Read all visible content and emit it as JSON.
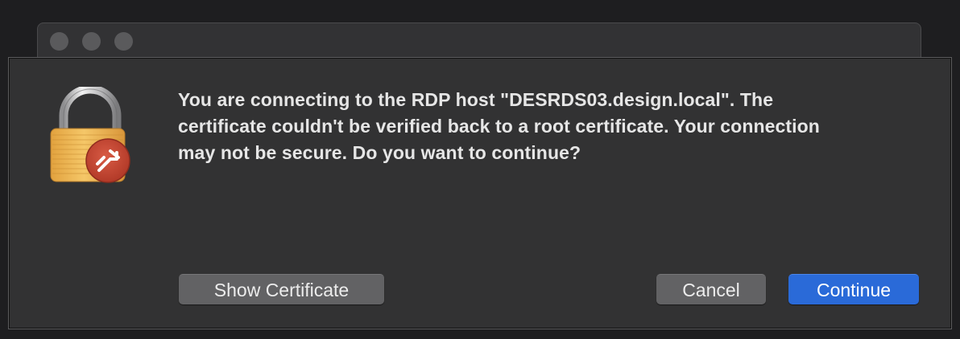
{
  "alert": {
    "message_lines": [
      "You are connecting to the RDP host \"DESRDS03.design.local\". The",
      "certificate couldn't be verified back to a root certificate. Your connection",
      "may not be secure. Do you want to continue?"
    ],
    "icon": "lock-with-remote-desktop-badge-icon"
  },
  "buttons": {
    "show_certificate": "Show Certificate",
    "cancel": "Cancel",
    "continue": "Continue"
  },
  "colors": {
    "sheet_background": "#323233",
    "primary_button": "#2a6ad8",
    "secondary_button": "#626264",
    "badge_red": "#c94a36",
    "lock_gold": "#e6a94a"
  }
}
